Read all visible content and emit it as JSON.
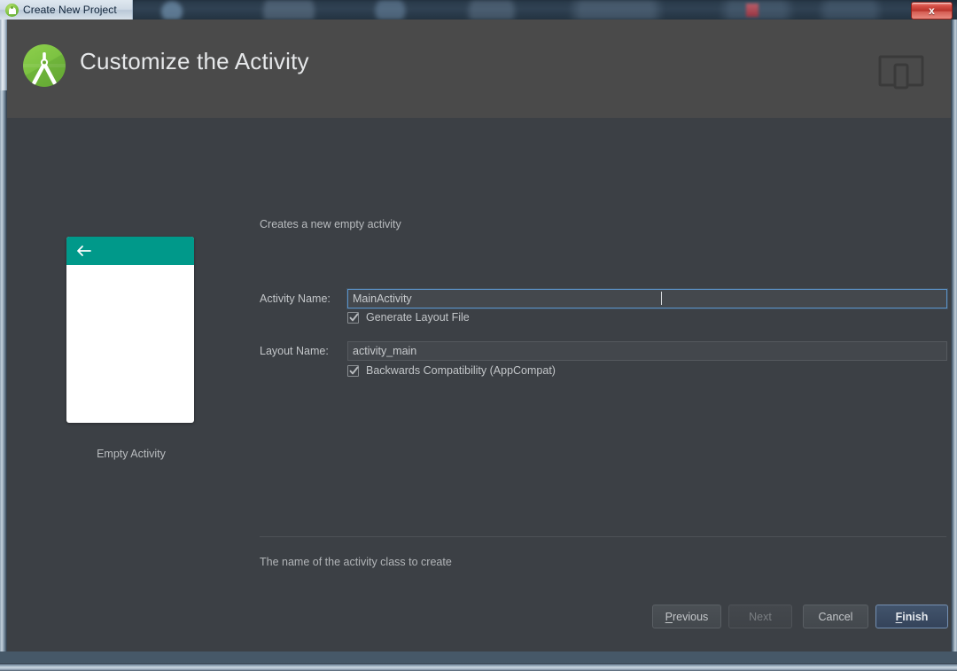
{
  "window": {
    "title": "Create New Project",
    "title_icon": "android-icon",
    "close_label": "x",
    "close_icon": "close-icon"
  },
  "header": {
    "title": "Customize the Activity",
    "logo_icon": "android-studio-logo",
    "device_icon": "device-preview-icon"
  },
  "preview": {
    "back_icon": "back-arrow-icon",
    "label": "Empty Activity",
    "appbar_color": "#00998a"
  },
  "form": {
    "description": "Creates a new empty activity",
    "fields": [
      {
        "label": "Activity Name:",
        "value": "MainActivity",
        "focused": true
      },
      {
        "label": "Layout Name:",
        "value": "activity_main",
        "focused": false
      }
    ],
    "checkboxes": [
      {
        "label": "Generate Layout File",
        "checked": true
      },
      {
        "label": "Backwards Compatibility (AppCompat)",
        "checked": true
      }
    ],
    "hint": "The name of the activity class to create"
  },
  "footer": {
    "buttons": [
      {
        "label": "Previous",
        "mnemonic": "P",
        "state": "enabled"
      },
      {
        "label": "Next",
        "mnemonic": "N",
        "state": "disabled"
      },
      {
        "label": "Cancel",
        "mnemonic": "",
        "state": "enabled"
      },
      {
        "label": "Finish",
        "mnemonic": "F",
        "state": "default"
      }
    ]
  },
  "colors": {
    "header_bg": "#4a4a4a",
    "body_bg": "#3c4045",
    "accent_focus": "#5b93c9",
    "teal": "#00998a",
    "android_green": "#7cc242"
  }
}
